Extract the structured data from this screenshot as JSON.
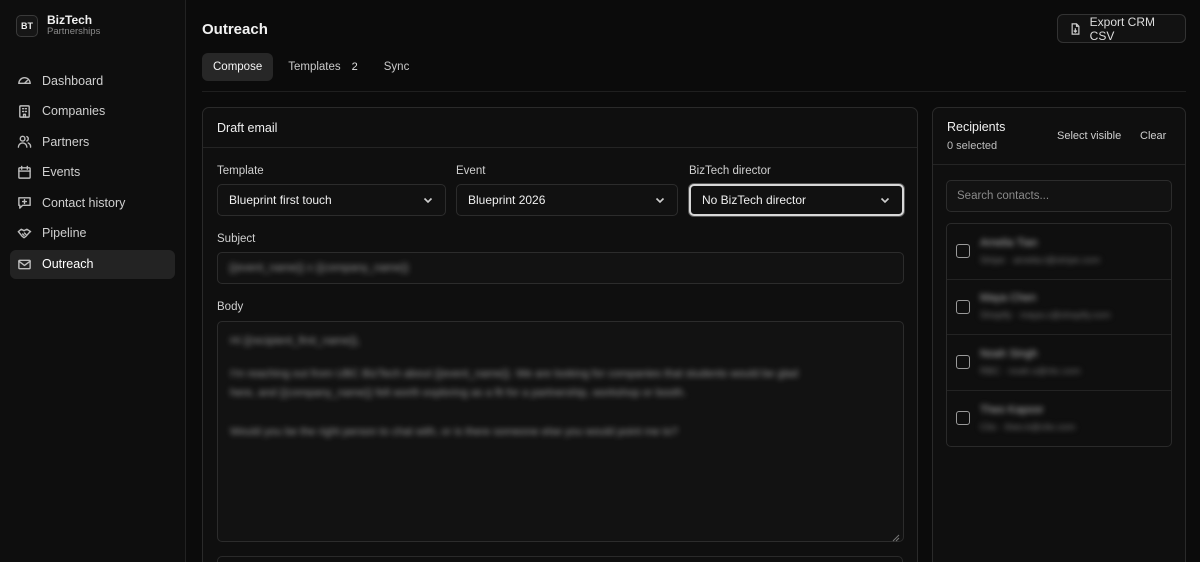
{
  "brand": {
    "logo": "BT",
    "name": "BizTech",
    "subtitle": "Partnerships"
  },
  "sidebar": {
    "items": [
      {
        "label": "Dashboard",
        "icon": "dashboard-icon"
      },
      {
        "label": "Companies",
        "icon": "building-icon"
      },
      {
        "label": "Partners",
        "icon": "users-icon"
      },
      {
        "label": "Events",
        "icon": "calendar-icon"
      },
      {
        "label": "Contact history",
        "icon": "message-icon"
      },
      {
        "label": "Pipeline",
        "icon": "handshake-icon"
      },
      {
        "label": "Outreach",
        "icon": "mail-icon",
        "active": true
      }
    ]
  },
  "header": {
    "title": "Outreach",
    "export_label": "Export CRM CSV"
  },
  "tabs": [
    {
      "label": "Compose",
      "active": true
    },
    {
      "label": "Templates",
      "count": "2"
    },
    {
      "label": "Sync"
    }
  ],
  "draft": {
    "title": "Draft email",
    "template_label": "Template",
    "template_value": "Blueprint first touch",
    "event_label": "Event",
    "event_value": "Blueprint 2026",
    "director_label": "BizTech director",
    "director_value": "No BizTech director",
    "subject_label": "Subject",
    "subject_value": "{{event_name}} x {{company_name}}",
    "body_label": "Body",
    "body_lines": [
      "Hi {{recipient_first_name}},",
      "I'm reaching out from UBC BizTech about {{event_name}}. We are looking for companies that students would be glad",
      "here, and {{company_name}} felt worth exploring as a fit for a partnership, workshop or booth.",
      "Would you be the right person to chat with, or is there someone else you would point me to?"
    ]
  },
  "recipients": {
    "title": "Recipients",
    "count_text": "0 selected",
    "select_visible": "Select visible",
    "clear": "Clear",
    "search_placeholder": "Search contacts...",
    "items": [
      {
        "name": "Amelia Tian",
        "meta": "Stripe · amelia.t@stripe.com"
      },
      {
        "name": "Maya Chen",
        "meta": "Shopify · maya.c@shopify.com"
      },
      {
        "name": "Noah Singh",
        "meta": "RBC · noah.s@rbc.com"
      },
      {
        "name": "Theo Kapoor",
        "meta": "Clio · theo.k@clio.com"
      }
    ]
  }
}
